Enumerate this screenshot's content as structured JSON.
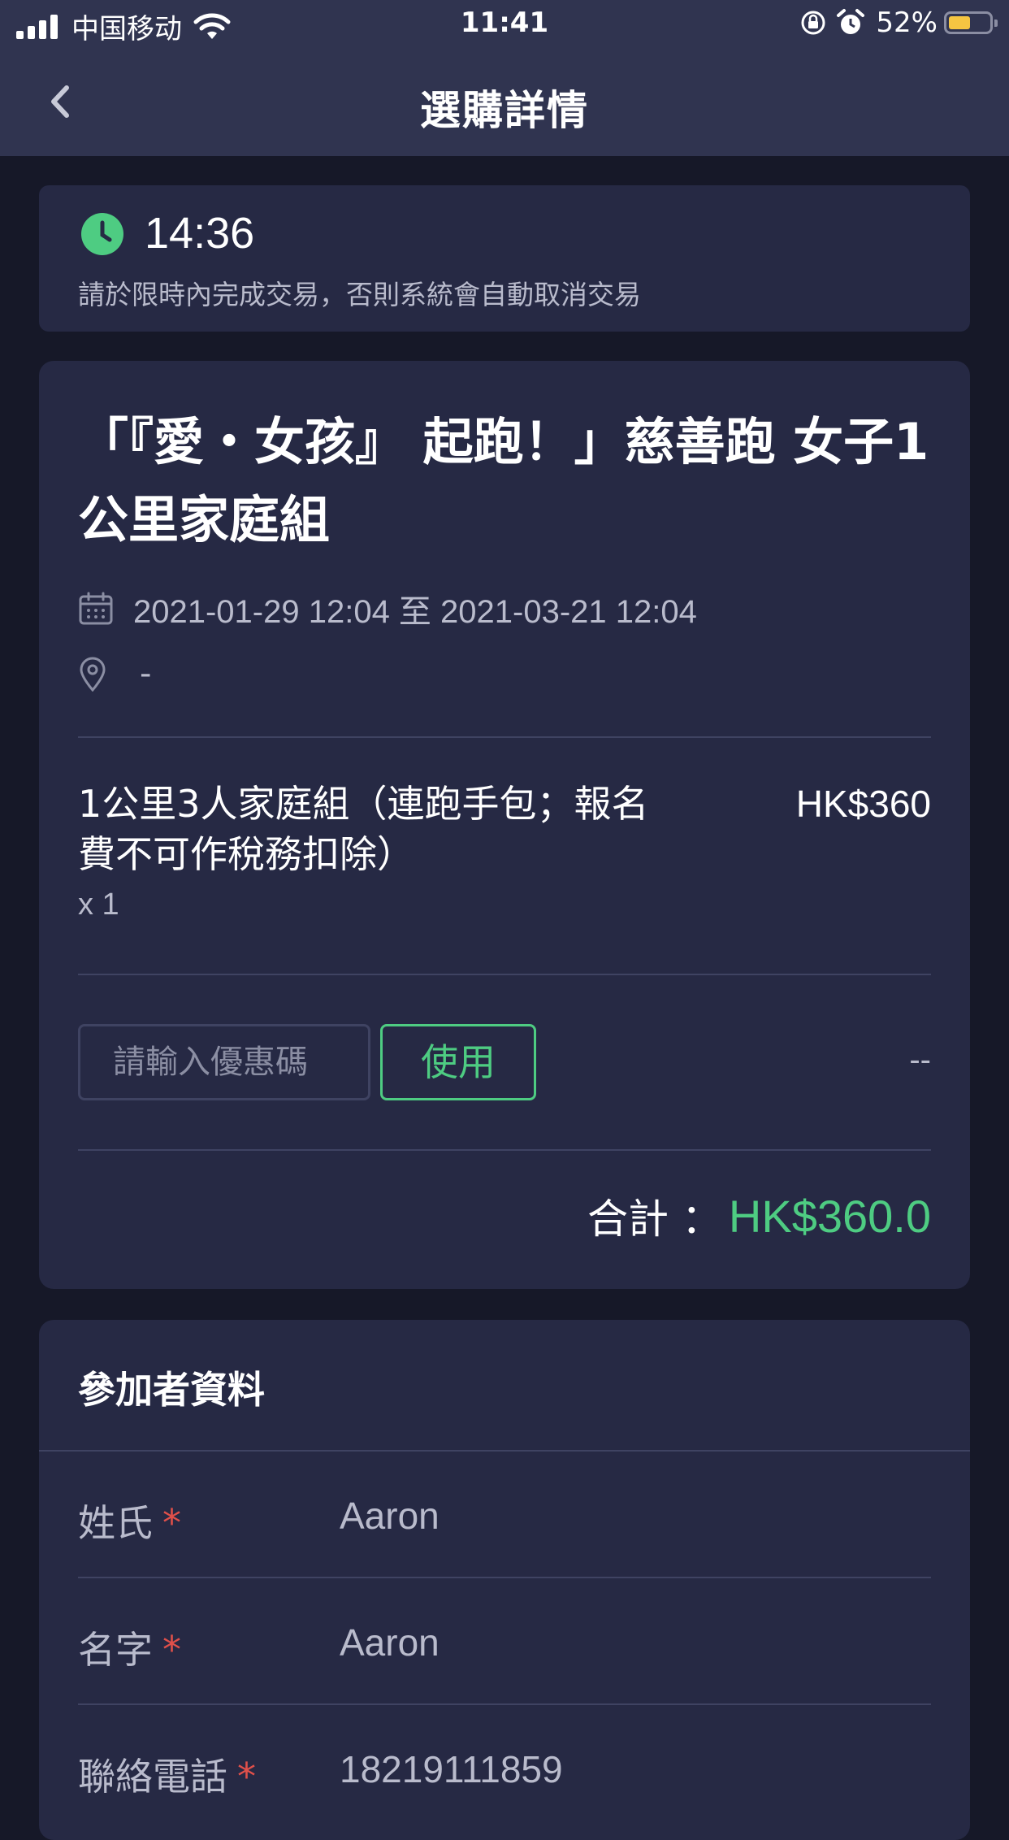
{
  "status_bar": {
    "carrier": "中国移动",
    "time": "11:41",
    "battery_percent": "52%",
    "battery_level": 0.52
  },
  "nav": {
    "title": "選購詳情",
    "back_icon": "chevron-left-icon"
  },
  "timer": {
    "icon": "clock-icon",
    "value": "14:36",
    "note": "請於限時內完成交易，否則系統會自動取消交易"
  },
  "order": {
    "event_title": "「『愛・女孩』 起跑！」慈善跑 女子1公里家庭組",
    "date_range": "2021-01-29 12:04 至 2021-03-21 12:04",
    "location": "-",
    "item": {
      "name": "1公里3人家庭組（連跑手包；報名費不可作稅務扣除）",
      "price": "HK$360",
      "quantity": "x 1"
    },
    "coupon": {
      "placeholder": "請輸入優惠碼",
      "button_label": "使用",
      "discount": "--"
    },
    "total": {
      "label": "合計 ：",
      "value": "HK$360.0"
    }
  },
  "participant": {
    "section_title": "參加者資料",
    "fields": [
      {
        "label": "姓氏",
        "required": "*",
        "value": "Aaron"
      },
      {
        "label": "名字",
        "required": "*",
        "value": "Aaron"
      },
      {
        "label": "聯絡電話",
        "required": "*",
        "value": "18219111859"
      }
    ]
  },
  "colors": {
    "accent_green": "#4ecc82",
    "required_red": "#e0504a",
    "card_bg": "#262944",
    "header_bg": "#303450"
  }
}
